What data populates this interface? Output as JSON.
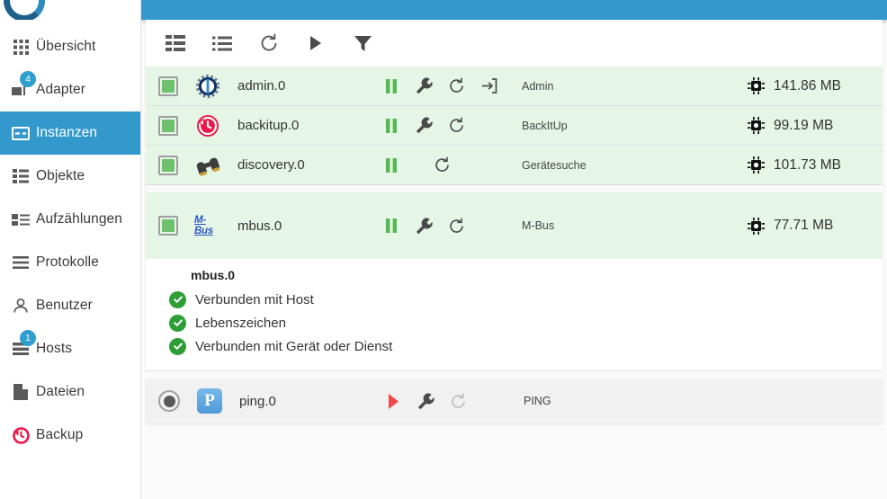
{
  "app": {
    "accent_color": "#3399cc",
    "row_active_color": "#e6f6e6",
    "row_inactive_color": "#f1f1f1"
  },
  "sidebar": {
    "logo_name": "iobroker-logo",
    "items": [
      {
        "label": "Übersicht",
        "icon": "grid-icon",
        "badge": "",
        "active": false
      },
      {
        "label": "Adapter",
        "icon": "adapter-icon",
        "badge": "4",
        "active": false
      },
      {
        "label": "Instanzen",
        "icon": "instances-icon",
        "badge": "",
        "active": true
      },
      {
        "label": "Objekte",
        "icon": "objects-icon",
        "badge": "",
        "active": false
      },
      {
        "label": "Aufzählungen",
        "icon": "enums-icon",
        "badge": "",
        "active": false
      },
      {
        "label": "Protokolle",
        "icon": "logs-icon",
        "badge": "",
        "active": false
      },
      {
        "label": "Benutzer",
        "icon": "user-icon",
        "badge": "",
        "active": false
      },
      {
        "label": "Hosts",
        "icon": "hosts-icon",
        "badge": "1",
        "active": false
      },
      {
        "label": "Dateien",
        "icon": "files-icon",
        "badge": "",
        "active": false
      },
      {
        "label": "Backup",
        "icon": "backup-icon",
        "badge": "",
        "active": false
      }
    ]
  },
  "topbar": {
    "icons": [
      "chevron-down-icon",
      "chevron-down-icon",
      "square-icon"
    ]
  },
  "toolbar": {
    "buttons": [
      {
        "name": "table-view-button",
        "icon": "table-list-icon"
      },
      {
        "name": "list-view-button",
        "icon": "bullet-list-icon"
      },
      {
        "name": "refresh-button",
        "icon": "refresh-icon"
      },
      {
        "name": "start-all-button",
        "icon": "play-icon"
      },
      {
        "name": "filter-button",
        "icon": "filter-icon"
      }
    ]
  },
  "instances": [
    {
      "id": "admin.0",
      "icon": "admin-icon",
      "title": "Admin",
      "memory": "141.86 MB",
      "running": true,
      "actions": [
        "pause-icon",
        "wrench-icon",
        "refresh-icon",
        "open-link-icon"
      ]
    },
    {
      "id": "backitup.0",
      "icon": "backitup-icon",
      "title": "BackItUp",
      "memory": "99.19 MB",
      "running": true,
      "actions": [
        "pause-icon",
        "wrench-icon",
        "refresh-icon"
      ]
    },
    {
      "id": "discovery.0",
      "icon": "discovery-icon",
      "title": "Gerätesuche",
      "memory": "101.73 MB",
      "running": true,
      "actions": [
        "pause-icon",
        "refresh-icon"
      ]
    },
    {
      "id": "mbus.0",
      "icon": "mbus-icon",
      "icon_text": "M-Bus",
      "title": "M-Bus",
      "memory": "77.71 MB",
      "running": true,
      "expanded": true,
      "actions": [
        "pause-icon",
        "wrench-icon",
        "refresh-icon"
      ]
    },
    {
      "id": "ping.0",
      "icon": "ping-icon",
      "icon_text": "P",
      "title": "PING",
      "memory": "",
      "running": false,
      "actions": [
        "play-icon",
        "wrench-icon",
        "refresh-icon"
      ]
    }
  ],
  "detail_panel": {
    "title": "mbus.0",
    "items": [
      {
        "label": "Verbunden mit Host",
        "status": "ok"
      },
      {
        "label": "Lebenszeichen",
        "status": "ok"
      },
      {
        "label": "Verbunden mit Gerät oder Dienst",
        "status": "ok"
      }
    ]
  }
}
